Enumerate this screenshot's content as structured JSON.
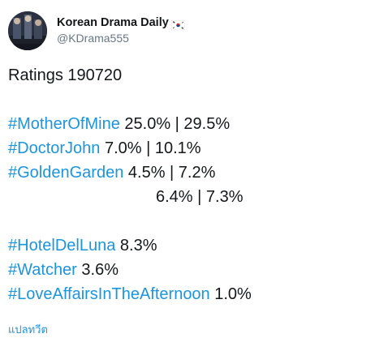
{
  "author": {
    "display_name": "Korean Drama Daily",
    "flag_icon": "south-korea-flag-icon",
    "handle": "@KDrama555",
    "avatar_icon": "profile-photo"
  },
  "tweet": {
    "title_line": "Ratings 190720",
    "entries": [
      {
        "hashtag": "#MotherOfMine",
        "value": " 25.0% | 29.5%"
      },
      {
        "hashtag": "#DoctorJohn",
        "value": " 7.0% | 10.1%"
      },
      {
        "hashtag": "#GoldenGarden",
        "value": " 4.5% | 7.2%"
      }
    ],
    "continuation_line": "6.4% | 7.3%",
    "entries_2": [
      {
        "hashtag": "#HotelDelLuna",
        "value": " 8.3%"
      },
      {
        "hashtag": "#Watcher",
        "value": " 3.6%"
      },
      {
        "hashtag": "#LoveAffairsInTheAfternoon",
        "value": " 1.0%"
      }
    ],
    "translate_link": "แปลทวีต"
  },
  "colors": {
    "link": "#1b95e0",
    "text": "#14171a",
    "secondary": "#657786"
  }
}
